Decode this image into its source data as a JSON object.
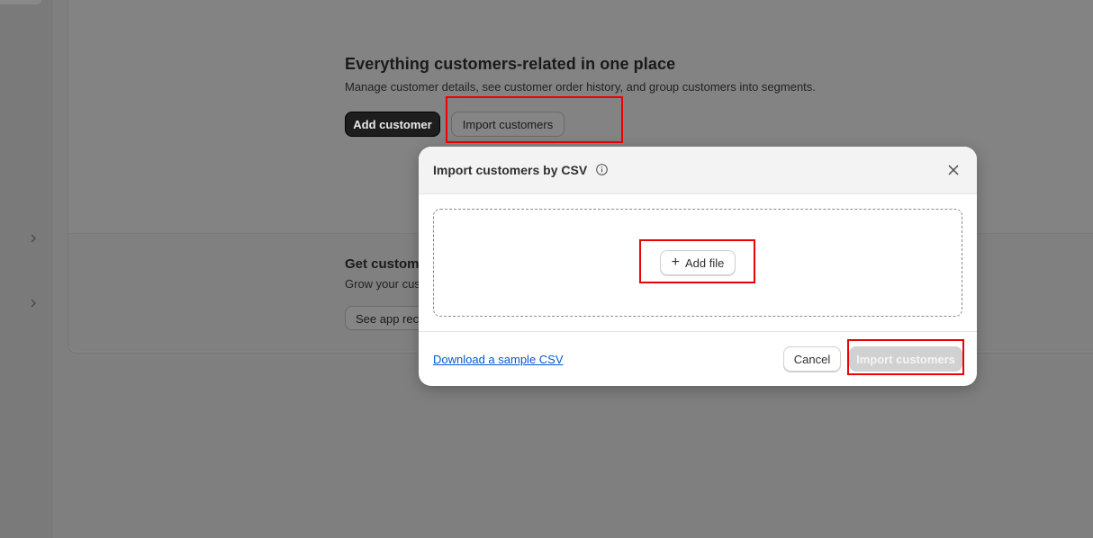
{
  "hero": {
    "title": "Everything customers-related in one place",
    "description": "Manage customer details, see customer order history, and group customers into segments.",
    "add_customer_label": "Add customer",
    "import_customers_label": "Import customers"
  },
  "section": {
    "title": "Get custome",
    "description": "Grow your cus",
    "app_button_label": "See app reco"
  },
  "modal": {
    "title": "Import customers by CSV",
    "add_file_label": "Add file",
    "download_link": "Download a sample CSV",
    "cancel_label": "Cancel",
    "import_label": "Import customers"
  },
  "colors": {
    "accent_link": "#005bd3",
    "annotation_box": "#e00000",
    "primary_dark": "#1d1d1d"
  },
  "icons": [
    "chevron-right-icon",
    "info-icon",
    "close-icon",
    "plus-icon"
  ]
}
